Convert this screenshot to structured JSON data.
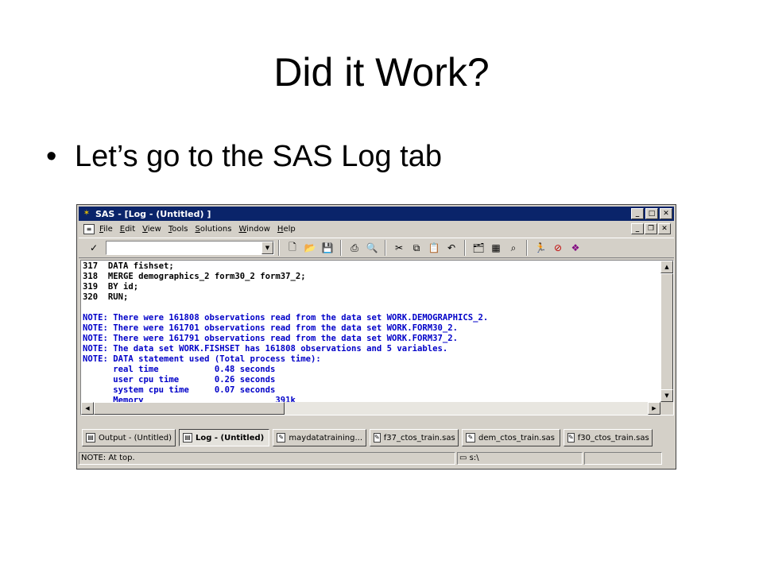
{
  "slide": {
    "title": "Did it Work?",
    "bullet": "Let’s go to the SAS Log tab"
  },
  "window": {
    "title": "SAS - [Log - (Untitled) ]",
    "app_icon": "sas-app-icon",
    "caption_buttons": [
      "minimize",
      "maximize",
      "close"
    ]
  },
  "menu": {
    "items": [
      "File",
      "Edit",
      "View",
      "Tools",
      "Solutions",
      "Window",
      "Help"
    ],
    "mnemonics": [
      "F",
      "E",
      "V",
      "T",
      "S",
      "W",
      "H"
    ]
  },
  "toolbar": {
    "command_value": "",
    "icons": [
      "new-icon",
      "open-icon",
      "save-icon",
      "print-icon",
      "print-preview-icon",
      "cut-icon",
      "copy-icon",
      "paste-icon",
      "undo-icon",
      "explorer-icon",
      "libraries-icon",
      "find-icon",
      "run-icon",
      "break-icon",
      "help-icon"
    ]
  },
  "log": {
    "lines": [
      {
        "kind": "code",
        "text": "317  DATA fishset;"
      },
      {
        "kind": "code",
        "text": "318  MERGE demographics_2 form30_2 form37_2;"
      },
      {
        "kind": "code",
        "text": "319  BY id;"
      },
      {
        "kind": "code",
        "text": "320  RUN;"
      },
      {
        "kind": "blank",
        "text": ""
      },
      {
        "kind": "note",
        "text": "NOTE: There were 161808 observations read from the data set WORK.DEMOGRAPHICS_2."
      },
      {
        "kind": "note",
        "text": "NOTE: There were 161701 observations read from the data set WORK.FORM30_2."
      },
      {
        "kind": "note",
        "text": "NOTE: There were 161791 observations read from the data set WORK.FORM37_2."
      },
      {
        "kind": "note",
        "text": "NOTE: The data set WORK.FISHSET has 161808 observations and 5 variables."
      },
      {
        "kind": "note",
        "text": "NOTE: DATA statement used (Total process time):"
      },
      {
        "kind": "note",
        "text": "      real time           0.48 seconds"
      },
      {
        "kind": "note",
        "text": "      user cpu time       0.26 seconds"
      },
      {
        "kind": "note",
        "text": "      system cpu time     0.07 seconds"
      },
      {
        "kind": "note",
        "text": "      Memory                          391k"
      }
    ]
  },
  "tasks": [
    {
      "label": "Output - (Untitled)",
      "active": false
    },
    {
      "label": "Log - (Untitled)",
      "active": true
    },
    {
      "label": "maydatatraining...",
      "active": false
    },
    {
      "label": "f37_ctos_train.sas",
      "active": false
    },
    {
      "label": "dem_ctos_train.sas",
      "active": false
    },
    {
      "label": "f30_ctos_train.sas",
      "active": false
    }
  ],
  "status": {
    "message": "NOTE: At top.",
    "directory": "s:\\"
  }
}
